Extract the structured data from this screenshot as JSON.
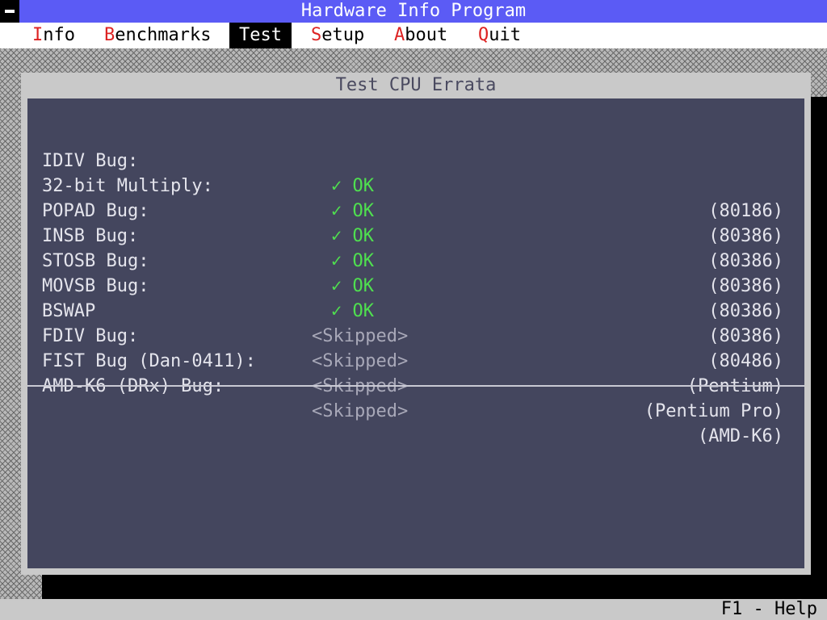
{
  "app": {
    "title": "Hardware Info Program"
  },
  "menu": [
    {
      "hot": "I",
      "rest": "nfo",
      "active": false
    },
    {
      "hot": "B",
      "rest": "enchmarks",
      "active": false
    },
    {
      "hot": "T",
      "rest": "est",
      "active": true
    },
    {
      "hot": "S",
      "rest": "etup",
      "active": false
    },
    {
      "hot": "A",
      "rest": "bout",
      "active": false
    },
    {
      "hot": "Q",
      "rest": "uit",
      "active": false
    }
  ],
  "window": {
    "title": "Test CPU Errata",
    "tests": [
      {
        "label": "IDIV Bug:",
        "result": "✓ OK",
        "status": "ok",
        "cpu": "(80186)"
      },
      {
        "label": "32-bit Multiply:",
        "result": "✓ OK",
        "status": "ok",
        "cpu": "(80386)"
      },
      {
        "label": "POPAD Bug:",
        "result": "✓ OK",
        "status": "ok",
        "cpu": "(80386)"
      },
      {
        "label": "INSB Bug:",
        "result": "✓ OK",
        "status": "ok",
        "cpu": "(80386)"
      },
      {
        "label": "STOSB Bug:",
        "result": "✓ OK",
        "status": "ok",
        "cpu": "(80386)"
      },
      {
        "label": "MOVSB Bug:",
        "result": "✓ OK",
        "status": "ok",
        "cpu": "(80386)"
      },
      {
        "label": "BSWAP",
        "result": "<Skipped>",
        "status": "skipped",
        "cpu": "(80486)"
      },
      {
        "label": "FDIV Bug:",
        "result": "<Skipped>",
        "status": "skipped",
        "cpu": "(Pentium)"
      },
      {
        "label": "FIST Bug (Dan-0411):",
        "result": "<Skipped>",
        "status": "skipped",
        "cpu": "(Pentium Pro)"
      },
      {
        "label": "AMD-K6 (DRx) Bug:",
        "result": "<Skipped>",
        "status": "skipped",
        "cpu": "(AMD-K6)"
      }
    ]
  },
  "status": {
    "help": "F1 - Help"
  },
  "colors": {
    "title_bar": "#5b5bf5",
    "ok": "#4fe04f",
    "hotkey": "#d22222",
    "panel": "#44465e"
  }
}
